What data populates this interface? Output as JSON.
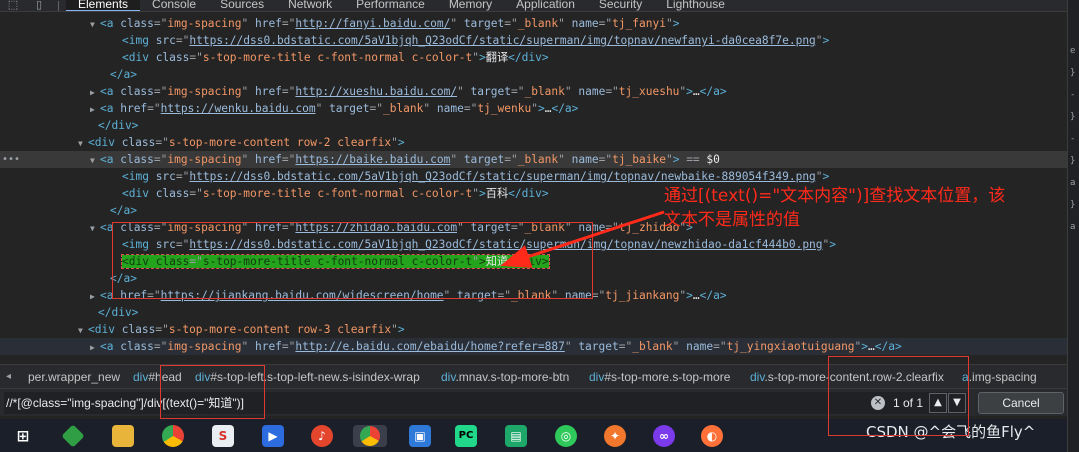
{
  "devtools": {
    "tabs": [
      "Elements",
      "Console",
      "Sources",
      "Network",
      "Performance",
      "Memory",
      "Application",
      "Security",
      "Lighthouse"
    ],
    "active_tab": "Elements",
    "toolbar_icons": [
      "inspect-icon",
      "device-toolbar-icon"
    ]
  },
  "dom_rows": [
    {
      "indent": 100,
      "tri": "open",
      "text": [
        [
          "t",
          "<a "
        ],
        [
          "a",
          "class"
        ],
        [
          "eq",
          "=\""
        ],
        [
          "v",
          "img-spacing"
        ],
        [
          "eq",
          "\" "
        ],
        [
          "a",
          "href"
        ],
        [
          "eq",
          "=\""
        ],
        [
          "l",
          "http://fanyi.baidu.com/"
        ],
        [
          "eq",
          "\" "
        ],
        [
          "a",
          "target"
        ],
        [
          "eq",
          "=\""
        ],
        [
          "v",
          "_blank"
        ],
        [
          "eq",
          "\" "
        ],
        [
          "a",
          "name"
        ],
        [
          "eq",
          "=\""
        ],
        [
          "v",
          "tj_fanyi"
        ],
        [
          "eq",
          "\""
        ],
        [
          "t",
          ">"
        ]
      ]
    },
    {
      "indent": 122,
      "tri": "",
      "text": [
        [
          "t",
          "<img "
        ],
        [
          "a",
          "src"
        ],
        [
          "eq",
          "=\""
        ],
        [
          "l",
          "https://dss0.bdstatic.com/5aV1bjqh_Q23odCf/static/superman/img/topnav/newfanyi-da0cea8f7e.png"
        ],
        [
          "eq",
          "\""
        ],
        [
          "t",
          ">"
        ]
      ]
    },
    {
      "indent": 122,
      "tri": "",
      "text": [
        [
          "t",
          "<div "
        ],
        [
          "a",
          "class"
        ],
        [
          "eq",
          "=\""
        ],
        [
          "v",
          "s-top-more-title c-font-normal c-color-t"
        ],
        [
          "eq",
          "\""
        ],
        [
          "t",
          ">"
        ],
        [
          "tx",
          "翻译"
        ],
        [
          "t",
          "</div>"
        ]
      ]
    },
    {
      "indent": 110,
      "tri": "",
      "text": [
        [
          "t",
          "</a>"
        ]
      ]
    },
    {
      "indent": 100,
      "tri": "closed",
      "text": [
        [
          "t",
          "<a "
        ],
        [
          "a",
          "class"
        ],
        [
          "eq",
          "=\""
        ],
        [
          "v",
          "img-spacing"
        ],
        [
          "eq",
          "\" "
        ],
        [
          "a",
          "href"
        ],
        [
          "eq",
          "=\""
        ],
        [
          "l",
          "http://xueshu.baidu.com/"
        ],
        [
          "eq",
          "\" "
        ],
        [
          "a",
          "target"
        ],
        [
          "eq",
          "=\""
        ],
        [
          "v",
          "_blank"
        ],
        [
          "eq",
          "\" "
        ],
        [
          "a",
          "name"
        ],
        [
          "eq",
          "=\""
        ],
        [
          "v",
          "tj_xueshu"
        ],
        [
          "eq",
          "\""
        ],
        [
          "t",
          ">"
        ],
        [
          "tx",
          "…"
        ],
        [
          "t",
          "</a>"
        ]
      ]
    },
    {
      "indent": 100,
      "tri": "closed",
      "text": [
        [
          "t",
          "<a "
        ],
        [
          "a",
          "href"
        ],
        [
          "eq",
          "=\""
        ],
        [
          "l",
          "https://wenku.baidu.com"
        ],
        [
          "eq",
          "\" "
        ],
        [
          "a",
          "target"
        ],
        [
          "eq",
          "=\""
        ],
        [
          "v",
          "_blank"
        ],
        [
          "eq",
          "\" "
        ],
        [
          "a",
          "name"
        ],
        [
          "eq",
          "=\""
        ],
        [
          "v",
          "tj_wenku"
        ],
        [
          "eq",
          "\""
        ],
        [
          "t",
          ">"
        ],
        [
          "tx",
          "…"
        ],
        [
          "t",
          "</a>"
        ]
      ]
    },
    {
      "indent": 98,
      "tri": "",
      "text": [
        [
          "t",
          "</div>"
        ]
      ]
    },
    {
      "indent": 88,
      "tri": "open",
      "text": [
        [
          "t",
          "<div "
        ],
        [
          "a",
          "class"
        ],
        [
          "eq",
          "=\""
        ],
        [
          "v",
          "s-top-more-content row-2 clearfix"
        ],
        [
          "eq",
          "\""
        ],
        [
          "t",
          ">"
        ]
      ]
    },
    {
      "indent": 100,
      "tri": "open",
      "sel": true,
      "dots": true,
      "text": [
        [
          "t",
          "<a "
        ],
        [
          "a",
          "class"
        ],
        [
          "eq",
          "=\""
        ],
        [
          "v",
          "img-spacing"
        ],
        [
          "eq",
          "\" "
        ],
        [
          "a",
          "href"
        ],
        [
          "eq",
          "=\""
        ],
        [
          "l",
          "https://baike.baidu.com"
        ],
        [
          "eq",
          "\" "
        ],
        [
          "a",
          "target"
        ],
        [
          "eq",
          "=\""
        ],
        [
          "v",
          "_blank"
        ],
        [
          "eq",
          "\" "
        ],
        [
          "a",
          "name"
        ],
        [
          "eq",
          "=\""
        ],
        [
          "v",
          "tj_baike"
        ],
        [
          "eq",
          "\""
        ],
        [
          "t",
          ">"
        ],
        [
          "eq",
          " == "
        ],
        [
          "tx",
          "$0"
        ]
      ]
    },
    {
      "indent": 122,
      "tri": "",
      "text": [
        [
          "t",
          "<img "
        ],
        [
          "a",
          "src"
        ],
        [
          "eq",
          "=\""
        ],
        [
          "l",
          "https://dss0.bdstatic.com/5aV1bjqh_Q23odCf/static/superman/img/topnav/newbaike-889054f349.png"
        ],
        [
          "eq",
          "\""
        ],
        [
          "t",
          ">"
        ]
      ]
    },
    {
      "indent": 122,
      "tri": "",
      "text": [
        [
          "t",
          "<div "
        ],
        [
          "a",
          "class"
        ],
        [
          "eq",
          "=\""
        ],
        [
          "v",
          "s-top-more-title c-font-normal c-color-t"
        ],
        [
          "eq",
          "\""
        ],
        [
          "t",
          ">"
        ],
        [
          "tx",
          "百科"
        ],
        [
          "t",
          "</div>"
        ]
      ]
    },
    {
      "indent": 110,
      "tri": "",
      "text": [
        [
          "t",
          "</a>"
        ]
      ]
    },
    {
      "indent": 100,
      "tri": "open",
      "text": [
        [
          "t",
          "<a "
        ],
        [
          "a",
          "class"
        ],
        [
          "eq",
          "=\""
        ],
        [
          "v",
          "img-spacing"
        ],
        [
          "eq",
          "\" "
        ],
        [
          "a",
          "href"
        ],
        [
          "eq",
          "=\""
        ],
        [
          "l",
          "https://zhidao.baidu.com"
        ],
        [
          "eq",
          "\" "
        ],
        [
          "a",
          "target"
        ],
        [
          "eq",
          "=\""
        ],
        [
          "v",
          "_blank"
        ],
        [
          "eq",
          "\" "
        ],
        [
          "a",
          "name"
        ],
        [
          "eq",
          "=\""
        ],
        [
          "v",
          "tj_zhidao"
        ],
        [
          "eq",
          "\""
        ],
        [
          "t",
          ">"
        ]
      ]
    },
    {
      "indent": 122,
      "tri": "",
      "text": [
        [
          "t",
          "<img "
        ],
        [
          "a",
          "src"
        ],
        [
          "eq",
          "=\""
        ],
        [
          "l",
          "https://dss0.bdstatic.com/5aV1bjqh_Q23odCf/static/superman/img/topnav/newzhidao-da1cf444b0.png"
        ],
        [
          "eq",
          "\""
        ],
        [
          "t",
          ">"
        ]
      ]
    },
    {
      "indent": 122,
      "tri": "",
      "hl": true,
      "text": [
        [
          "t",
          "<div "
        ],
        [
          "a",
          "class"
        ],
        [
          "eq",
          "=\""
        ],
        [
          "v",
          "s-top-more-title c-font-normal c-color-t"
        ],
        [
          "eq",
          "\""
        ],
        [
          "t",
          ">"
        ],
        [
          "tx",
          "知道"
        ],
        [
          "t",
          "</div>"
        ]
      ]
    },
    {
      "indent": 110,
      "tri": "",
      "text": [
        [
          "t",
          "</a>"
        ]
      ]
    },
    {
      "indent": 100,
      "tri": "closed",
      "text": [
        [
          "t",
          "<a "
        ],
        [
          "a",
          "href"
        ],
        [
          "eq",
          "=\""
        ],
        [
          "l",
          "https://jiankang.baidu.com/widescreen/home"
        ],
        [
          "eq",
          "\" "
        ],
        [
          "a",
          "target"
        ],
        [
          "eq",
          "=\""
        ],
        [
          "v",
          "_blank"
        ],
        [
          "eq",
          "\" "
        ],
        [
          "a",
          "name"
        ],
        [
          "eq",
          "=\""
        ],
        [
          "v",
          "tj_jiankang"
        ],
        [
          "eq",
          "\""
        ],
        [
          "t",
          ">"
        ],
        [
          "tx",
          "…"
        ],
        [
          "t",
          "</a>"
        ]
      ]
    },
    {
      "indent": 98,
      "tri": "",
      "text": [
        [
          "t",
          "</div>"
        ]
      ]
    },
    {
      "indent": 88,
      "tri": "open",
      "text": [
        [
          "t",
          "<div "
        ],
        [
          "a",
          "class"
        ],
        [
          "eq",
          "=\""
        ],
        [
          "v",
          "s-top-more-content row-3 clearfix"
        ],
        [
          "eq",
          "\""
        ],
        [
          "t",
          ">"
        ]
      ]
    },
    {
      "indent": 100,
      "tri": "closed",
      "hov": true,
      "text": [
        [
          "t",
          "<a "
        ],
        [
          "a",
          "class"
        ],
        [
          "eq",
          "=\""
        ],
        [
          "v",
          "img-spacing"
        ],
        [
          "eq",
          "\" "
        ],
        [
          "a",
          "href"
        ],
        [
          "eq",
          "=\""
        ],
        [
          "l",
          "http://e.baidu.com/ebaidu/home?refer=887"
        ],
        [
          "eq",
          "\" "
        ],
        [
          "a",
          "target"
        ],
        [
          "eq",
          "=\""
        ],
        [
          "v",
          "_blank"
        ],
        [
          "eq",
          "\" "
        ],
        [
          "a",
          "name"
        ],
        [
          "eq",
          "=\""
        ],
        [
          "v",
          "tj_yingxiaotuiguang"
        ],
        [
          "eq",
          "\""
        ],
        [
          "t",
          ">"
        ],
        [
          "tx",
          "…"
        ],
        [
          "t",
          "</a>"
        ]
      ]
    }
  ],
  "breadcrumb": [
    {
      "tag": "",
      "rest": "per.wrapper_new"
    },
    {
      "tag": "div",
      "rest": "#head"
    },
    {
      "tag": "div",
      "rest": "#s-top-left.s-top-left-new.s-isindex-wrap"
    },
    {
      "tag": "div",
      "rest": ".mnav.s-top-more-btn"
    },
    {
      "tag": "div",
      "rest": "#s-top-more.s-top-more"
    },
    {
      "tag": "div",
      "rest": ".s-top-more-content.row-2.clearfix"
    },
    {
      "tag": "a",
      "rest": ".img-spacing"
    }
  ],
  "search": {
    "query": "//*[@class=\"img-spacing\"]/div[(text()=\"知道\")]",
    "count": "1 of 1",
    "cancel_label": "Cancel"
  },
  "annotation": {
    "text": "通过[(text()=\"文本内容\")]查找文本位置，该\n文本不是属性的值",
    "color": "#ff2a1a"
  },
  "side_panel_glyphs": [
    "e",
    "}",
    "-",
    "}",
    "-",
    "}",
    "a",
    "}",
    "a"
  ],
  "taskbar": {
    "apps": [
      "windows-start-icon",
      "taskbar-app-green-diamond-icon",
      "file-explorer-icon",
      "chrome-icon",
      "sogou-app-icon",
      "video-player-icon",
      "cloud-music-icon",
      "chrome-active-icon",
      "window-app-icon",
      "pycharm-icon",
      "green-app-icon",
      "wechat-icon",
      "browser-icon",
      "mask-app-icon",
      "firefox-icon"
    ],
    "watermark": "CSDN @^会飞的鱼Fly^"
  },
  "colors": {
    "tag": "#5db0d7",
    "attr_name": "#9bbbdc",
    "attr_value": "#f29766",
    "highlight": "#24a31c",
    "annotation": "#ff2a1a"
  }
}
